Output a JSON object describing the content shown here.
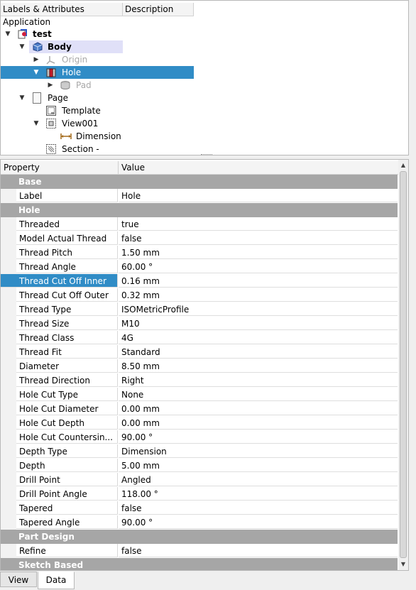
{
  "tree": {
    "headers": [
      "Labels & Attributes",
      "Description"
    ],
    "root_label": "Application",
    "items": [
      {
        "label": "test",
        "arrow": "▼",
        "icon": "document-icon"
      },
      {
        "label": "Body",
        "arrow": "▼",
        "icon": "body-icon"
      },
      {
        "label": "Origin",
        "arrow": "▶",
        "icon": "origin-icon"
      },
      {
        "label": "Hole",
        "arrow": "▼",
        "icon": "hole-icon"
      },
      {
        "label": "Pad",
        "arrow": "▶",
        "icon": "pad-icon"
      },
      {
        "label": "Page",
        "arrow": "▼",
        "icon": "page-icon"
      },
      {
        "label": "Template",
        "arrow": "",
        "icon": "template-icon"
      },
      {
        "label": "View001",
        "arrow": "▼",
        "icon": "view-icon"
      },
      {
        "label": "Dimension",
        "arrow": "",
        "icon": "dimension-icon"
      },
      {
        "label": "Section  -",
        "arrow": "",
        "icon": "section-icon"
      }
    ]
  },
  "properties": {
    "headers": {
      "property": "Property",
      "value": "Value"
    },
    "rows": [
      {
        "group": "Base"
      },
      {
        "name": "Label",
        "value": "Hole"
      },
      {
        "group": "Hole"
      },
      {
        "name": "Threaded",
        "value": "true"
      },
      {
        "name": "Model Actual Thread",
        "value": "false"
      },
      {
        "name": "Thread Pitch",
        "value": "1.50 mm"
      },
      {
        "name": "Thread Angle",
        "value": "60.00 °"
      },
      {
        "name": "Thread Cut Off Inner",
        "value": "0.16 mm",
        "selected": true
      },
      {
        "name": "Thread Cut Off Outer",
        "value": "0.32 mm"
      },
      {
        "name": "Thread Type",
        "value": "ISOMetricProfile"
      },
      {
        "name": "Thread Size",
        "value": "M10"
      },
      {
        "name": "Thread Class",
        "value": "4G"
      },
      {
        "name": "Thread Fit",
        "value": "Standard"
      },
      {
        "name": "Diameter",
        "value": "8.50 mm"
      },
      {
        "name": "Thread Direction",
        "value": "Right"
      },
      {
        "name": "Hole Cut Type",
        "value": "None"
      },
      {
        "name": "Hole Cut Diameter",
        "value": "0.00 mm"
      },
      {
        "name": "Hole Cut Depth",
        "value": "0.00 mm"
      },
      {
        "name": "Hole Cut Countersin...",
        "value": "90.00 °"
      },
      {
        "name": "Depth Type",
        "value": "Dimension"
      },
      {
        "name": "Depth",
        "value": "5.00 mm"
      },
      {
        "name": "Drill Point",
        "value": "Angled"
      },
      {
        "name": "Drill Point Angle",
        "value": "118.00 °"
      },
      {
        "name": "Tapered",
        "value": "false"
      },
      {
        "name": "Tapered Angle",
        "value": "90.00 °"
      },
      {
        "group": "Part Design"
      },
      {
        "name": "Refine",
        "value": "false"
      },
      {
        "group": "Sketch Based"
      }
    ]
  },
  "tabs": [
    "View",
    "Data"
  ],
  "active_tab": "Data",
  "colors": {
    "selection": "#308cc6",
    "group_bg": "#a6a6a6"
  }
}
